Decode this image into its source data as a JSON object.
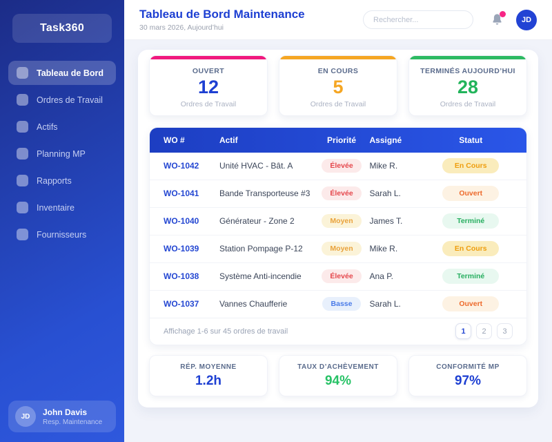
{
  "sidebar": {
    "logo": "Task360",
    "items": [
      {
        "label": "Tableau de Bord",
        "active": true
      },
      {
        "label": "Ordres de Travail",
        "active": false
      },
      {
        "label": "Actifs",
        "active": false
      },
      {
        "label": "Planning MP",
        "active": false
      },
      {
        "label": "Rapports",
        "active": false
      },
      {
        "label": "Inventaire",
        "active": false
      },
      {
        "label": "Fournisseurs",
        "active": false
      }
    ],
    "user": {
      "initials": "JD",
      "name": "John Davis",
      "role": "Resp. Maintenance"
    }
  },
  "header": {
    "title": "Tableau de Bord Maintenance",
    "date": "30 mars 2026, Aujourd’hui",
    "search_placeholder": "Rechercher...",
    "avatar_initials": "JD"
  },
  "stats": [
    {
      "label": "OUVERT",
      "value": "12",
      "sub": "Ordres de Travail",
      "accent": "#F0197E",
      "value_color": "#1D3FD2"
    },
    {
      "label": "EN COURS",
      "value": "5",
      "sub": "Ordres de Travail",
      "accent": "#F5A623",
      "value_color": "#F5A623"
    },
    {
      "label": "TERMINÉS AUJOURD’HUI",
      "value": "28",
      "sub": "Ordres de Travail",
      "accent": "#2DBA62",
      "value_color": "#22B45B"
    }
  ],
  "table": {
    "columns": [
      "WO #",
      "Actif",
      "Priorité",
      "Assigné",
      "Statut"
    ],
    "rows": [
      {
        "id": "WO-1042",
        "asset": "Unité HVAC - Bât. A",
        "priority": "Élevée",
        "assignee": "Mike R.",
        "status": "En Cours"
      },
      {
        "id": "WO-1041",
        "asset": "Bande Transporteuse #3",
        "priority": "Élevée",
        "assignee": "Sarah L.",
        "status": "Ouvert"
      },
      {
        "id": "WO-1040",
        "asset": "Générateur - Zone 2",
        "priority": "Moyen",
        "assignee": "James T.",
        "status": "Terminé"
      },
      {
        "id": "WO-1039",
        "asset": "Station Pompage P-12",
        "priority": "Moyen",
        "assignee": "Mike R.",
        "status": "En Cours"
      },
      {
        "id": "WO-1038",
        "asset": "Système Anti-incendie",
        "priority": "Élevée",
        "assignee": "Ana P.",
        "status": "Terminé"
      },
      {
        "id": "WO-1037",
        "asset": "Vannes Chaufferie",
        "priority": "Basse",
        "assignee": "Sarah L.",
        "status": "Ouvert"
      }
    ],
    "footer": "Affichage 1-6 sur 45 ordres de travail",
    "pages": [
      "1",
      "2",
      "3"
    ],
    "active_page": "1"
  },
  "badge_styles": {
    "Élevée": {
      "fg": "#E5484D",
      "bg": "#FCEAEA"
    },
    "Moyen": {
      "fg": "#E9A23B",
      "bg": "#FBF3D8"
    },
    "Basse": {
      "fg": "#4A7BE8",
      "bg": "#E8F0FC"
    },
    "En Cours": {
      "fg": "#EE9D0D",
      "bg": "#FAECBC"
    },
    "Ouvert": {
      "fg": "#ED6A2C",
      "bg": "#FDF2E3"
    },
    "Terminé": {
      "fg": "#27AE60",
      "bg": "#E8F8F0"
    }
  },
  "kpis": [
    {
      "label": "RÉP. MOYENNE",
      "value": "1.2h",
      "color": "#1D3FD2"
    },
    {
      "label": "TAUX D’ACHÈVEMENT",
      "value": "94%",
      "color": "#27C266"
    },
    {
      "label": "CONFORMITÉ MP",
      "value": "97%",
      "color": "#1D3FD2"
    }
  ],
  "colors": {
    "sidebar_top": "#1C2C87",
    "sidebar_bottom": "#2F58DD",
    "title_blue": "#1D3FD2",
    "table_header_blue": "#2A56E8",
    "notification_dot": "#F72585"
  }
}
